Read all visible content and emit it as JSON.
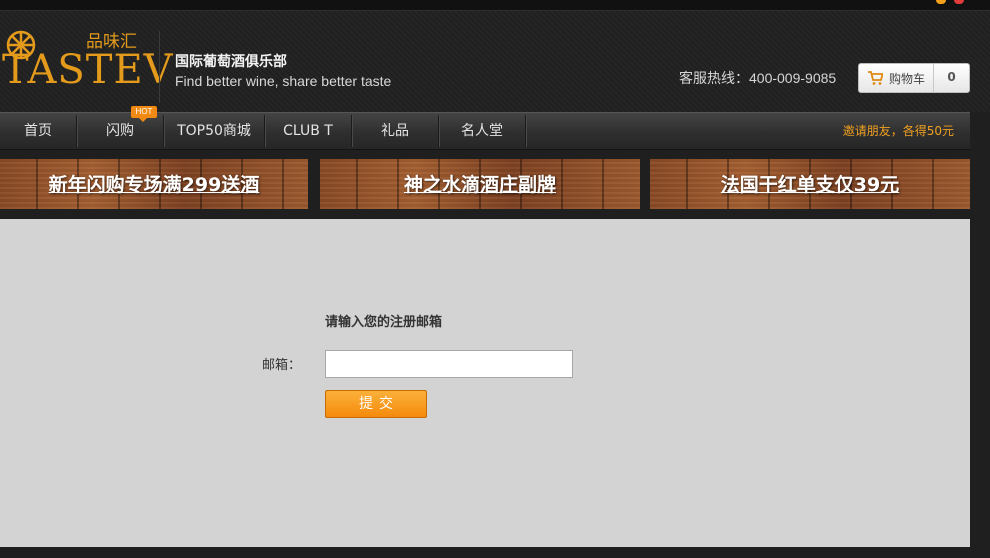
{
  "header": {
    "logo_word": "TASTEV",
    "logo_cn": "品味汇",
    "tagline_cn": "国际葡萄酒俱乐部",
    "tagline_en": "Find better wine, share better taste",
    "hotline": "客服热线：400-009-9085",
    "cart_label": "购物车",
    "cart_count": "0"
  },
  "nav": {
    "items": [
      {
        "label": "首页"
      },
      {
        "label": "闪购"
      },
      {
        "label": "TOP50商城"
      },
      {
        "label": "CLUB T"
      },
      {
        "label": "礼品"
      },
      {
        "label": "名人堂"
      }
    ],
    "hot_badge": "HOT",
    "invite": "邀请朋友，各得50元"
  },
  "banners": [
    {
      "text": "新年闪购专场满299送酒"
    },
    {
      "text": "神之水滴酒庄副牌"
    },
    {
      "text": "法国干红单支仅39元"
    }
  ],
  "form": {
    "heading": "请输入您的注册邮箱",
    "email_label": "邮箱：",
    "email_value": "",
    "submit_label": "提交"
  },
  "colors": {
    "brand_orange": "#e49b1c",
    "accent_orange": "#f58a0b",
    "content_bg": "#d3d3d3"
  }
}
